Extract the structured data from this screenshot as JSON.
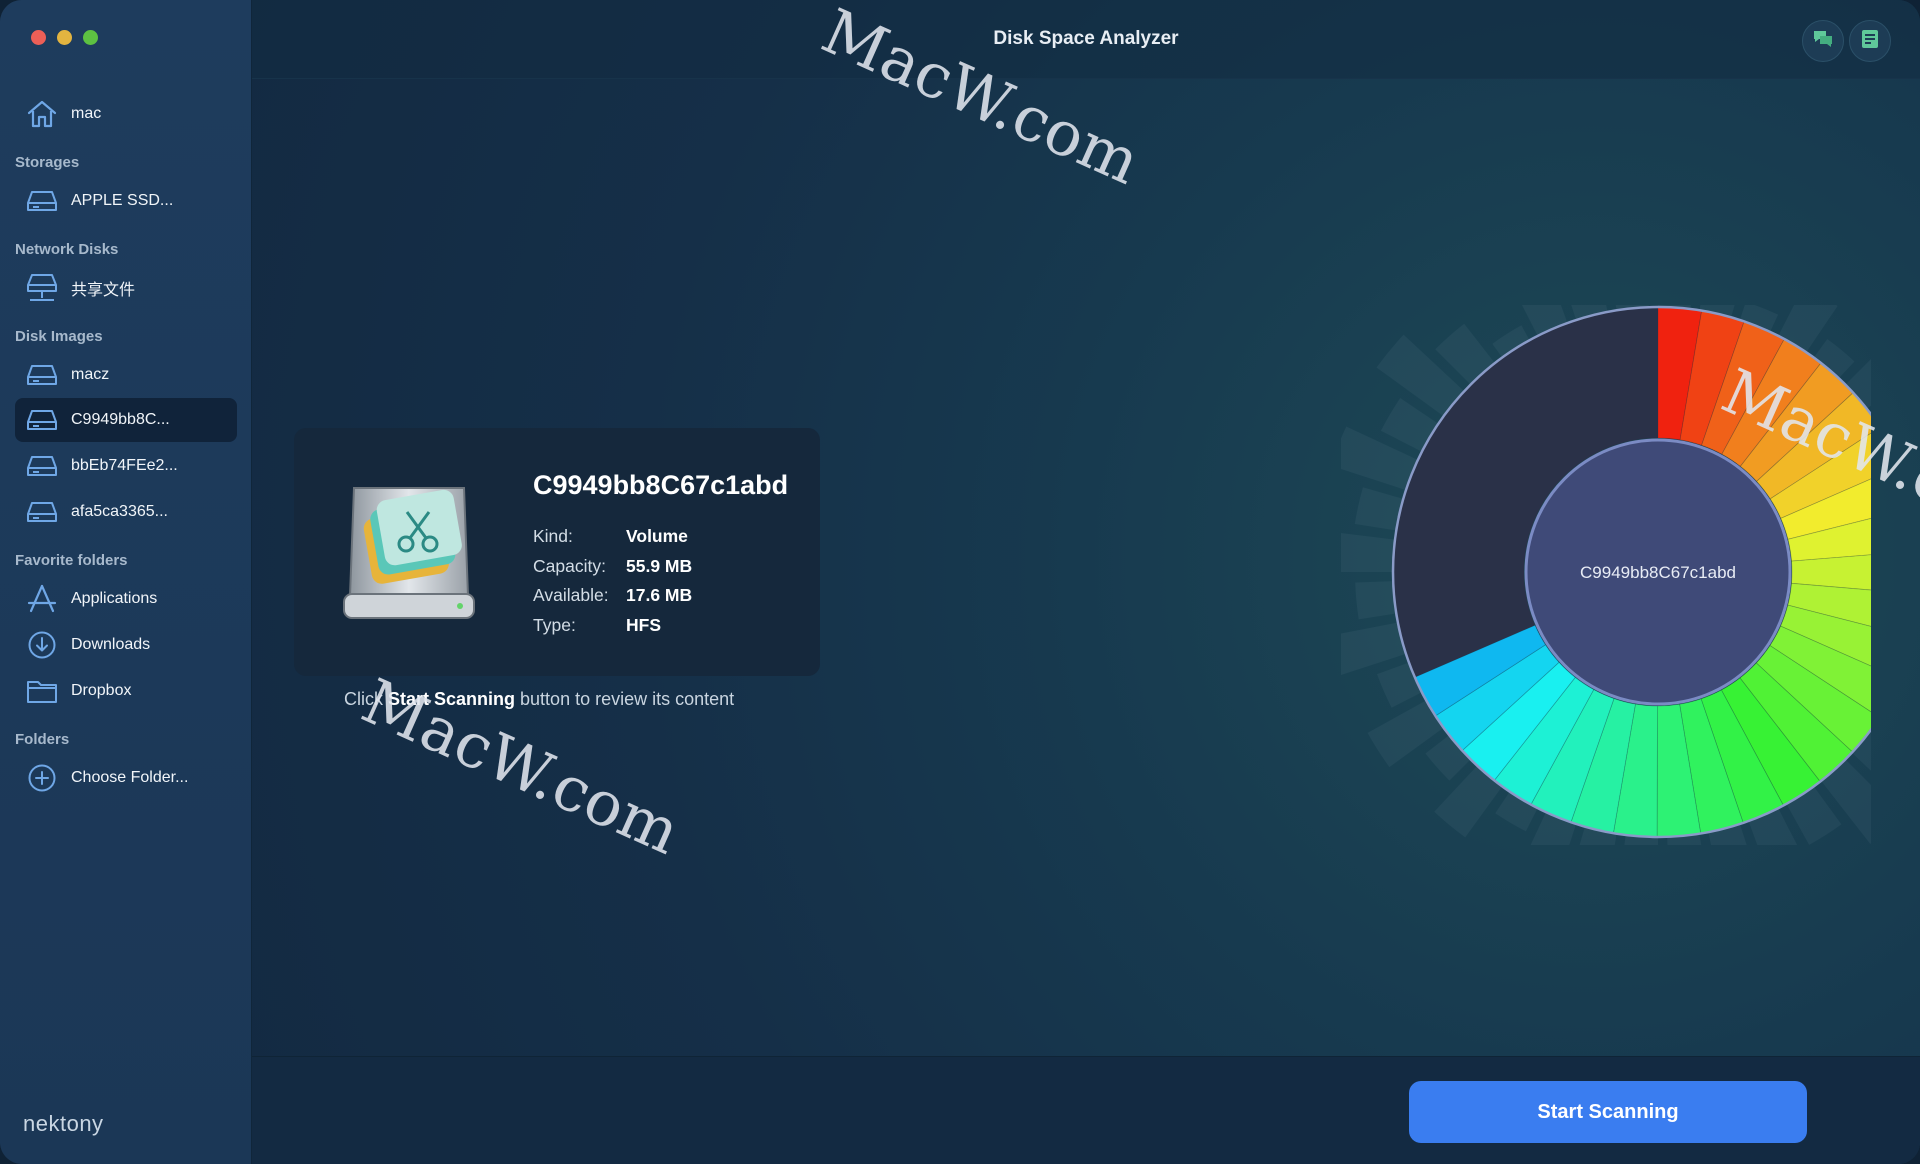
{
  "window": {
    "title": "Disk Space Analyzer"
  },
  "sidebar": {
    "home": {
      "label": "mac",
      "icon": "home-icon"
    },
    "sections": [
      {
        "title": "Storages",
        "items": [
          {
            "label": "APPLE SSD...",
            "icon": "drive-icon"
          }
        ]
      },
      {
        "title": "Network Disks",
        "items": [
          {
            "label": "共享文件",
            "icon": "network-drive-icon"
          }
        ]
      },
      {
        "title": "Disk Images",
        "items": [
          {
            "label": "macz",
            "icon": "drive-icon"
          },
          {
            "label": "C9949bb8C...",
            "icon": "drive-icon",
            "selected": true
          },
          {
            "label": "bbEb74FEe2...",
            "icon": "drive-icon"
          },
          {
            "label": "afa5ca3365...",
            "icon": "drive-icon"
          }
        ]
      },
      {
        "title": "Favorite folders",
        "items": [
          {
            "label": "Applications",
            "icon": "applications-icon"
          },
          {
            "label": "Downloads",
            "icon": "downloads-icon"
          },
          {
            "label": "Dropbox",
            "icon": "folder-icon"
          }
        ]
      },
      {
        "title": "Folders",
        "items": [
          {
            "label": "Choose Folder...",
            "icon": "plus-circle-icon"
          }
        ]
      }
    ],
    "brand": "nektony"
  },
  "toolbar": {
    "feedback_icon": "chat-bubbles-icon",
    "report_icon": "report-icon"
  },
  "info": {
    "name": "C9949bb8C67c1abd",
    "kind_label": "Kind:",
    "kind": "Volume",
    "capacity_label": "Capacity:",
    "capacity": "55.9 MB",
    "available_label": "Available:",
    "available": "17.6 MB",
    "type_label": "Type:",
    "type": "HFS"
  },
  "hint": {
    "prefix": "Click ",
    "emphasis": "Start Scanning",
    "suffix": " button to review its content"
  },
  "chart": {
    "center_label": "C9949bb8C67c1abd",
    "used_fraction": 0.685,
    "free_color": "#2a3148",
    "center_color": "#3f4a78"
  },
  "actions": {
    "start_scanning": "Start Scanning"
  },
  "watermark": {
    "text": "MacW.com"
  },
  "colors": {
    "accent": "#3a7df0"
  }
}
